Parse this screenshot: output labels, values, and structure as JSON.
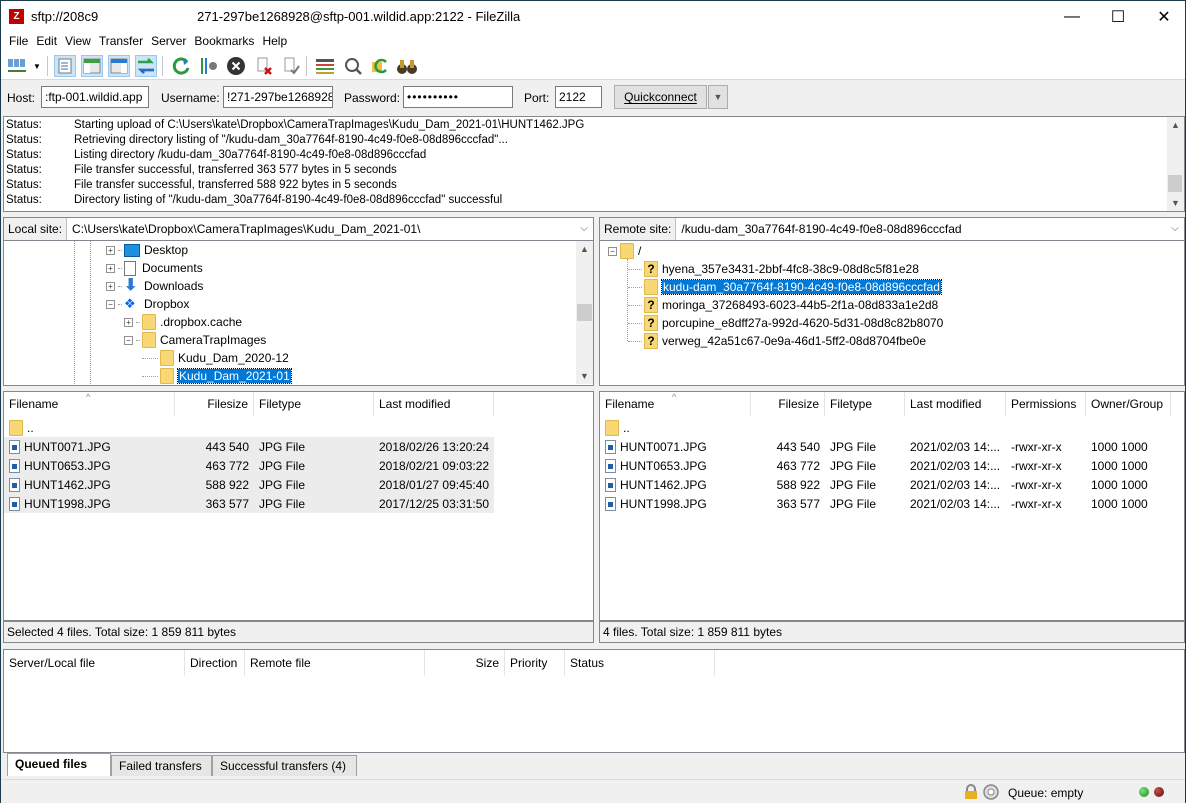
{
  "window": {
    "title_part1": "sftp://208c9",
    "title_part2": "271-297be1268928@sftp-001.wildid.app:2122 - FileZilla",
    "app_icon": "Z",
    "minimize": "—",
    "maximize": "☐",
    "close": "✕"
  },
  "menu": [
    "File",
    "Edit",
    "View",
    "Transfer",
    "Server",
    "Bookmarks",
    "Help"
  ],
  "toolbar": {
    "icons": [
      "site-manager-icon",
      "dropdown-arrow-icon",
      "toggle-message-log-icon",
      "toggle-local-tree-icon",
      "toggle-remote-tree-icon",
      "toggle-transfer-queue-icon",
      "refresh-icon",
      "process-queue-icon",
      "cancel-icon",
      "disconnect-icon",
      "reconnect-icon",
      "directory-filter-icon",
      "compare-directories-icon",
      "sync-browsing-icon",
      "search-files-icon"
    ]
  },
  "quickconnect": {
    "host_label": "Host:",
    "host_value": ":ftp-001.wildid.app",
    "username_label": "Username:",
    "username_value": "!271-297be1268928",
    "password_label": "Password:",
    "password_value": "••••••••••",
    "port_label": "Port:",
    "port_value": "2122",
    "button_label": "Quickconnect",
    "dropdown": "▼"
  },
  "log": [
    {
      "k": "Status:",
      "v": "Starting upload of C:\\Users\\kate\\Dropbox\\CameraTrapImages\\Kudu_Dam_2021-01\\HUNT1462.JPG"
    },
    {
      "k": "Status:",
      "v": "Retrieving directory listing of \"/kudu-dam_30a7764f-8190-4c49-f0e8-08d896cccfad\"..."
    },
    {
      "k": "Status:",
      "v": "Listing directory /kudu-dam_30a7764f-8190-4c49-f0e8-08d896cccfad"
    },
    {
      "k": "Status:",
      "v": "File transfer successful, transferred 363 577 bytes in 5 seconds"
    },
    {
      "k": "Status:",
      "v": "File transfer successful, transferred 588 922 bytes in 5 seconds"
    },
    {
      "k": "Status:",
      "v": "Directory listing of \"/kudu-dam_30a7764f-8190-4c49-f0e8-08d896cccfad\" successful"
    }
  ],
  "local": {
    "site_label": "Local site:",
    "path": "C:\\Users\\kate\\Dropbox\\CameraTrapImages\\Kudu_Dam_2021-01\\",
    "tree": [
      {
        "label": "Desktop"
      },
      {
        "label": "Documents"
      },
      {
        "label": "Downloads"
      },
      {
        "label": "Dropbox"
      },
      {
        "label": ".dropbox.cache"
      },
      {
        "label": "CameraTrapImages"
      },
      {
        "label": "Kudu_Dam_2020-12"
      },
      {
        "label": "Kudu_Dam_2021-01"
      }
    ],
    "columns": [
      "Filename",
      "Filesize",
      "Filetype",
      "Last modified"
    ],
    "parent": "..",
    "files": [
      {
        "name": "HUNT0071.JPG",
        "size": "443 540",
        "type": "JPG File",
        "modified": "2018/02/26 13:20:24"
      },
      {
        "name": "HUNT0653.JPG",
        "size": "463 772",
        "type": "JPG File",
        "modified": "2018/02/21 09:03:22"
      },
      {
        "name": "HUNT1462.JPG",
        "size": "588 922",
        "type": "JPG File",
        "modified": "2018/01/27 09:45:40"
      },
      {
        "name": "HUNT1998.JPG",
        "size": "363 577",
        "type": "JPG File",
        "modified": "2017/12/25 03:31:50"
      }
    ],
    "status": "Selected 4 files. Total size: 1 859 811 bytes"
  },
  "remote": {
    "site_label": "Remote site:",
    "path": "/kudu-dam_30a7764f-8190-4c49-f0e8-08d896cccfad",
    "tree_root": "/",
    "tree": [
      {
        "label": "hyena_357e3431-2bbf-4fc8-38c9-08d8c5f81e28",
        "unknown": true
      },
      {
        "label": "kudu-dam_30a7764f-8190-4c49-f0e8-08d896cccfad",
        "unknown": false
      },
      {
        "label": "moringa_37268493-6023-44b5-2f1a-08d833a1e2d8",
        "unknown": true
      },
      {
        "label": "porcupine_e8dff27a-992d-4620-5d31-08d8c82b8070",
        "unknown": true
      },
      {
        "label": "verweg_42a51c67-0e9a-46d1-5ff2-08d8704fbe0e",
        "unknown": true
      }
    ],
    "columns": [
      "Filename",
      "Filesize",
      "Filetype",
      "Last modified",
      "Permissions",
      "Owner/Group"
    ],
    "parent": "..",
    "files": [
      {
        "name": "HUNT0071.JPG",
        "size": "443 540",
        "type": "JPG File",
        "modified": "2021/02/03 14:...",
        "perm": "-rwxr-xr-x",
        "owner": "1000 1000"
      },
      {
        "name": "HUNT0653.JPG",
        "size": "463 772",
        "type": "JPG File",
        "modified": "2021/02/03 14:...",
        "perm": "-rwxr-xr-x",
        "owner": "1000 1000"
      },
      {
        "name": "HUNT1462.JPG",
        "size": "588 922",
        "type": "JPG File",
        "modified": "2021/02/03 14:...",
        "perm": "-rwxr-xr-x",
        "owner": "1000 1000"
      },
      {
        "name": "HUNT1998.JPG",
        "size": "363 577",
        "type": "JPG File",
        "modified": "2021/02/03 14:...",
        "perm": "-rwxr-xr-x",
        "owner": "1000 1000"
      }
    ],
    "status": "4 files. Total size: 1 859 811 bytes"
  },
  "queue": {
    "columns": [
      "Server/Local file",
      "Direction",
      "Remote file",
      "Size",
      "Priority",
      "Status"
    ],
    "tabs": [
      "Queued files",
      "Failed transfers",
      "Successful transfers (4)"
    ]
  },
  "statusbar": {
    "queue": "Queue: empty"
  },
  "colors": {
    "selection": "#0078d7",
    "folder": "#f8d775",
    "led_green": "#2a9d2a",
    "led_red": "#8b1a1a"
  }
}
